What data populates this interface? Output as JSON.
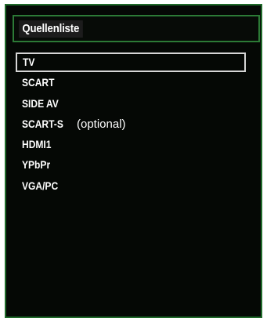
{
  "header": {
    "title": "Quellenliste"
  },
  "sources": [
    {
      "label": "TV",
      "suffix": "",
      "selected": true
    },
    {
      "label": "SCART",
      "suffix": "",
      "selected": false
    },
    {
      "label": "SIDE AV",
      "suffix": "",
      "selected": false
    },
    {
      "label": "SCART-S",
      "suffix": "(optional)",
      "selected": false
    },
    {
      "label": "HDMI1",
      "suffix": "",
      "selected": false
    },
    {
      "label": "YPbPr",
      "suffix": "",
      "selected": false
    },
    {
      "label": "VGA/PC",
      "suffix": "",
      "selected": false
    }
  ],
  "colors": {
    "background": "#050805",
    "border": "#1f6a2a",
    "highlight_border": "#d6d6d6"
  }
}
